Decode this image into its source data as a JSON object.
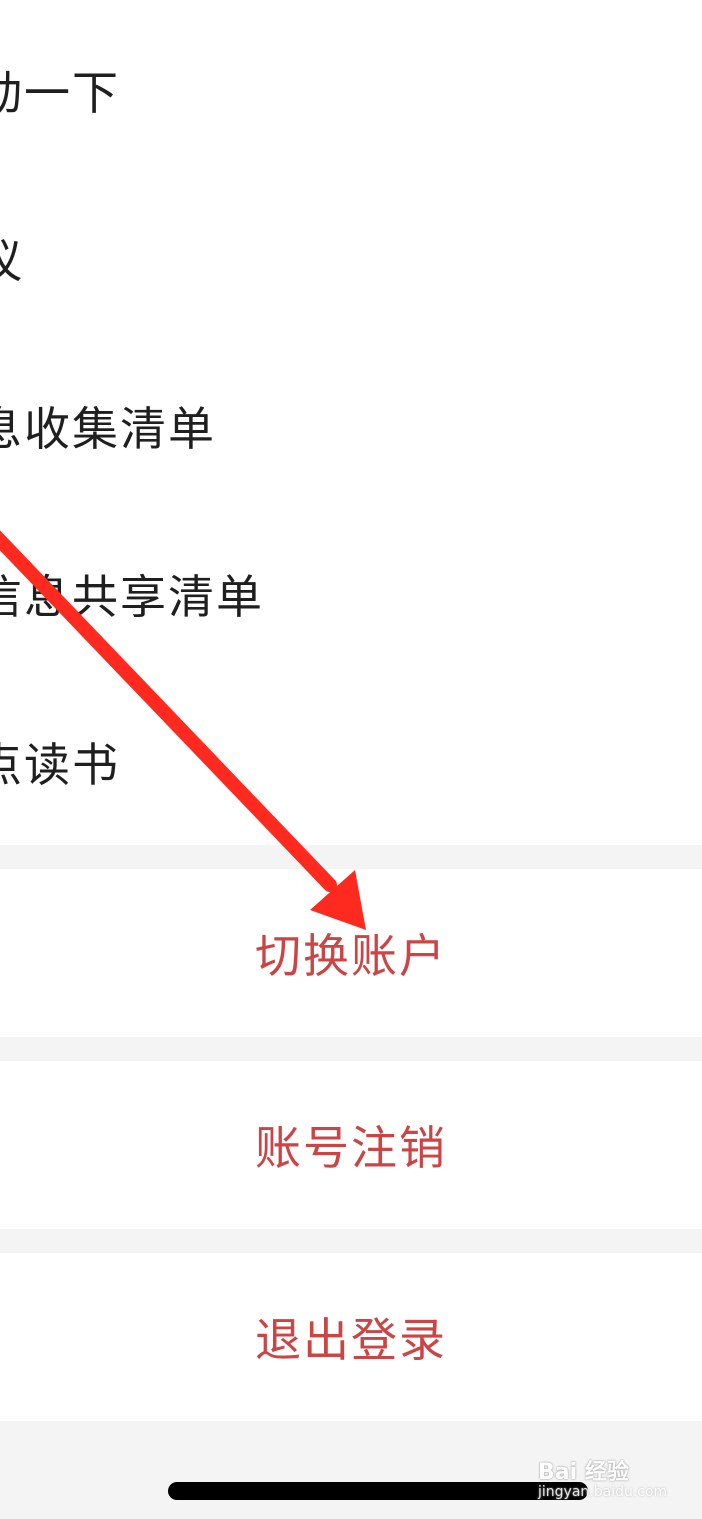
{
  "menu": {
    "items": [
      {
        "label": "动一下"
      },
      {
        "label": "议"
      },
      {
        "label": "息收集清单"
      },
      {
        "label": "信息共享清单"
      },
      {
        "label": "点读书"
      }
    ]
  },
  "actions": {
    "switch_account": "切换账户",
    "delete_account": "账号注销",
    "logout": "退出登录"
  },
  "watermark": {
    "logo_text": "Bai 经验",
    "url": "jingyan.baidu.com"
  },
  "colors": {
    "action_text": "#cc4444",
    "arrow": "#ff2a1f"
  }
}
